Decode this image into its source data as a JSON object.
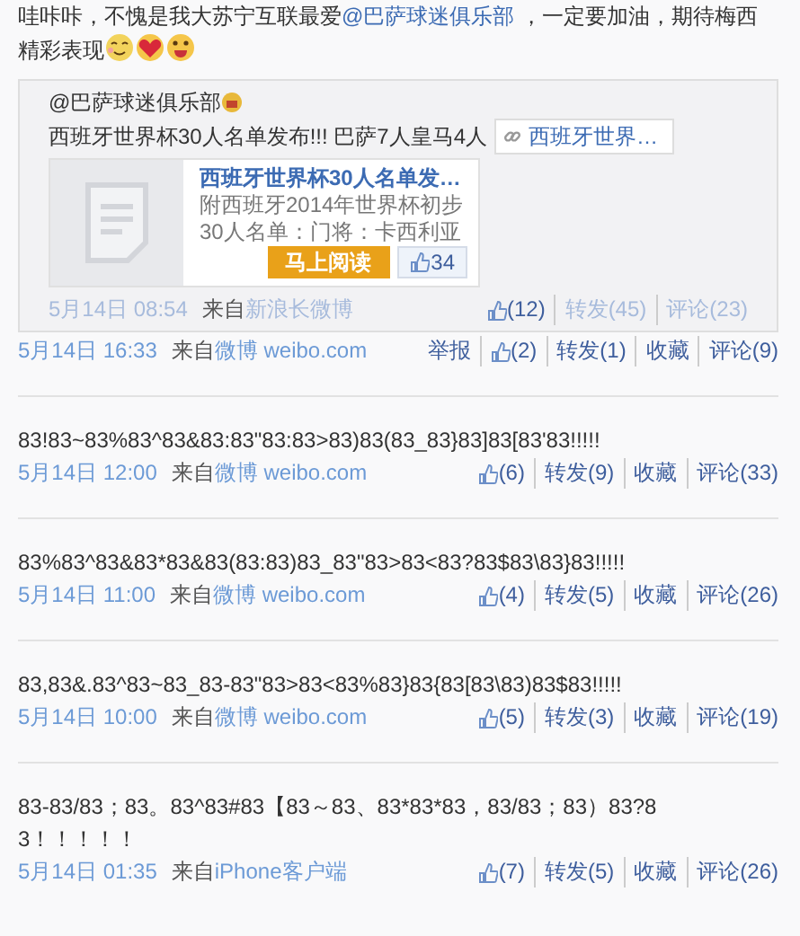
{
  "posts": [
    {
      "text_before": "哇咔咔，不愧是我大苏宁互联最爱",
      "mention": "@巴萨球迷俱乐部",
      "text_after": " ，一定要加油，期待梅西精彩表现",
      "repost": {
        "author": "@巴萨球迷俱乐部",
        "text": "西班牙世界杯30人名单发布!!! 巴萨7人皇马4人",
        "link_chip": "西班牙世界…",
        "card": {
          "title": "西班牙世界杯30人名单发…",
          "description": "附西班牙2014年世界杯初步30人名单：门将：卡西利亚",
          "button": "马上阅读",
          "likes": "34"
        },
        "time": "5月14日 08:54",
        "source_label": "来自",
        "source": "新浪长微博",
        "actions": [
          {
            "kind": "like",
            "label": "(12)"
          },
          {
            "kind": "link",
            "label": "转发(45)"
          },
          {
            "kind": "link",
            "label": "评论(23)"
          }
        ]
      },
      "time": "5月14日 16:33",
      "source_label": "来自",
      "source": "微博 weibo.com",
      "actions": [
        {
          "kind": "link",
          "label": "举报"
        },
        {
          "kind": "like",
          "label": "(2)"
        },
        {
          "kind": "link",
          "label": "转发(1)"
        },
        {
          "kind": "link",
          "label": "收藏"
        },
        {
          "kind": "link",
          "label": "评论(9)"
        }
      ]
    },
    {
      "text": "83!83~83%83^83&83:83\"83:83>83)83(83_83}83]83[83'83!!!!!",
      "time": "5月14日 12:00",
      "source_label": "来自",
      "source": "微博 weibo.com",
      "actions": [
        {
          "kind": "like",
          "label": "(6)"
        },
        {
          "kind": "link",
          "label": "转发(9)"
        },
        {
          "kind": "link",
          "label": "收藏"
        },
        {
          "kind": "link",
          "label": "评论(33)"
        }
      ]
    },
    {
      "text": "83%83^83&83*83&83(83:83)83_83\"83>83<83?83$83\\83}83!!!!!",
      "time": "5月14日 11:00",
      "source_label": "来自",
      "source": "微博 weibo.com",
      "actions": [
        {
          "kind": "like",
          "label": "(4)"
        },
        {
          "kind": "link",
          "label": "转发(5)"
        },
        {
          "kind": "link",
          "label": "收藏"
        },
        {
          "kind": "link",
          "label": "评论(26)"
        }
      ]
    },
    {
      "text": "83,83&.83^83~83_83-83\"83>83<83%83}83{83[83\\83)83$83!!!!!",
      "time": "5月14日 10:00",
      "source_label": "来自",
      "source": "微博 weibo.com",
      "actions": [
        {
          "kind": "like",
          "label": "(5)"
        },
        {
          "kind": "link",
          "label": "转发(3)"
        },
        {
          "kind": "link",
          "label": "收藏"
        },
        {
          "kind": "link",
          "label": "评论(19)"
        }
      ]
    },
    {
      "text": "83-83/83；83。83^83#83【83～83、83*83*83，83/83；83）83?83！！！！！",
      "time": "5月14日 01:35",
      "source_label": "来自",
      "source": "iPhone客户端",
      "actions": [
        {
          "kind": "like",
          "label": "(7)"
        },
        {
          "kind": "link",
          "label": "转发(5)"
        },
        {
          "kind": "link",
          "label": "收藏"
        },
        {
          "kind": "link",
          "label": "评论(26)"
        }
      ]
    }
  ]
}
